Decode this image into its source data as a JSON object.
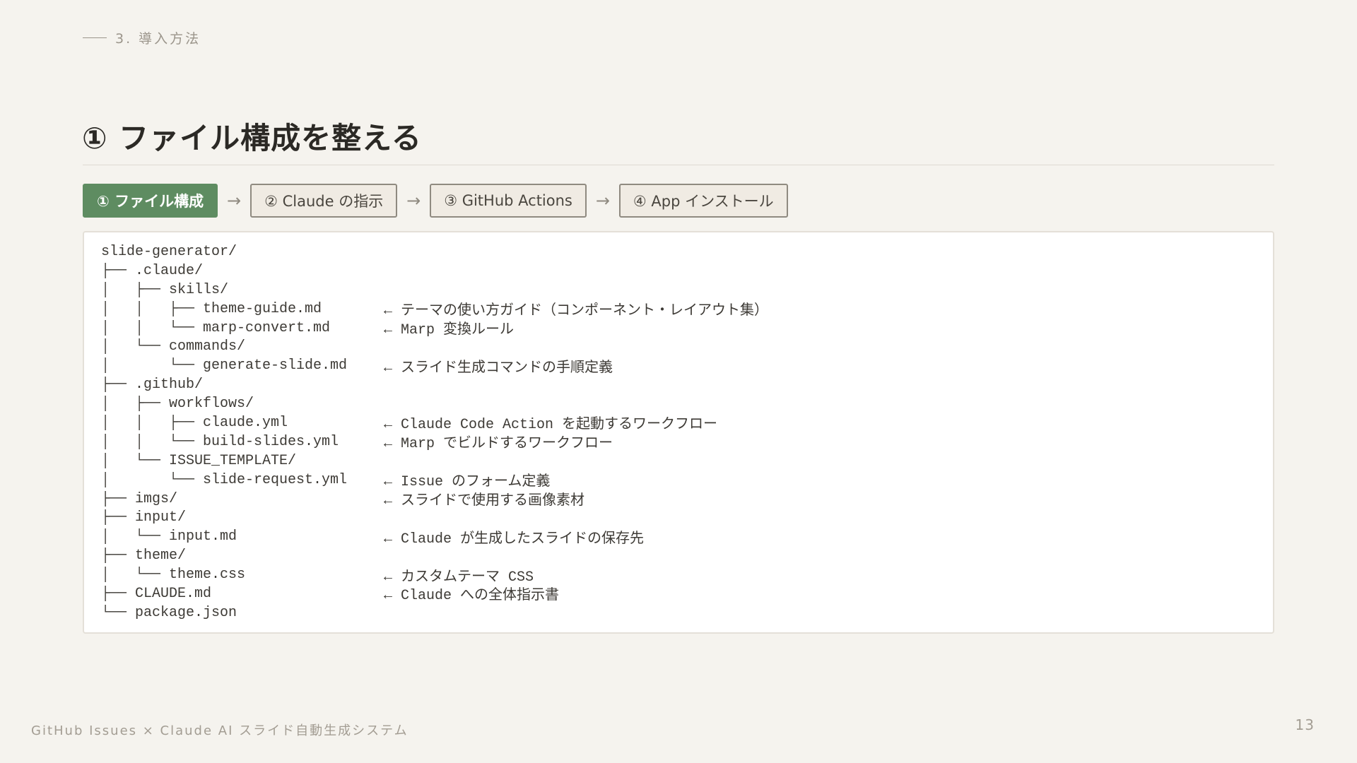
{
  "section": {
    "label": "3. 導入方法"
  },
  "title": "① ファイル構成を整える",
  "steps": [
    {
      "label": "① ファイル構成",
      "active": true
    },
    {
      "label": "② Claude の指示",
      "active": false
    },
    {
      "label": "③ GitHub Actions",
      "active": false
    },
    {
      "label": "④ App インストール",
      "active": false
    }
  ],
  "step_arrow": "→",
  "tree": [
    {
      "path": "slide-generator/",
      "note": ""
    },
    {
      "path": "├── .claude/",
      "note": ""
    },
    {
      "path": "│   ├── skills/",
      "note": ""
    },
    {
      "path": "│   │   ├── theme-guide.md",
      "note": "← テーマの使い方ガイド（コンポーネント・レイアウト集）"
    },
    {
      "path": "│   │   └── marp-convert.md",
      "note": "← Marp 変換ルール"
    },
    {
      "path": "│   └── commands/",
      "note": ""
    },
    {
      "path": "│       └── generate-slide.md",
      "note": "← スライド生成コマンドの手順定義"
    },
    {
      "path": "├── .github/",
      "note": ""
    },
    {
      "path": "│   ├── workflows/",
      "note": ""
    },
    {
      "path": "│   │   ├── claude.yml",
      "note": "← Claude Code Action を起動するワークフロー"
    },
    {
      "path": "│   │   └── build-slides.yml",
      "note": "← Marp でビルドするワークフロー"
    },
    {
      "path": "│   └── ISSUE_TEMPLATE/",
      "note": ""
    },
    {
      "path": "│       └── slide-request.yml",
      "note": "← Issue のフォーム定義"
    },
    {
      "path": "├── imgs/",
      "note": "← スライドで使用する画像素材"
    },
    {
      "path": "├── input/",
      "note": ""
    },
    {
      "path": "│   └── input.md",
      "note": "← Claude が生成したスライドの保存先"
    },
    {
      "path": "├── theme/",
      "note": ""
    },
    {
      "path": "│   └── theme.css",
      "note": "← カスタムテーマ CSS"
    },
    {
      "path": "├── CLAUDE.md",
      "note": "← Claude への全体指示書"
    },
    {
      "path": "└── package.json",
      "note": ""
    }
  ],
  "footer": {
    "left": "GitHub Issues × Claude AI スライド自動生成システム",
    "page_number": "13"
  }
}
